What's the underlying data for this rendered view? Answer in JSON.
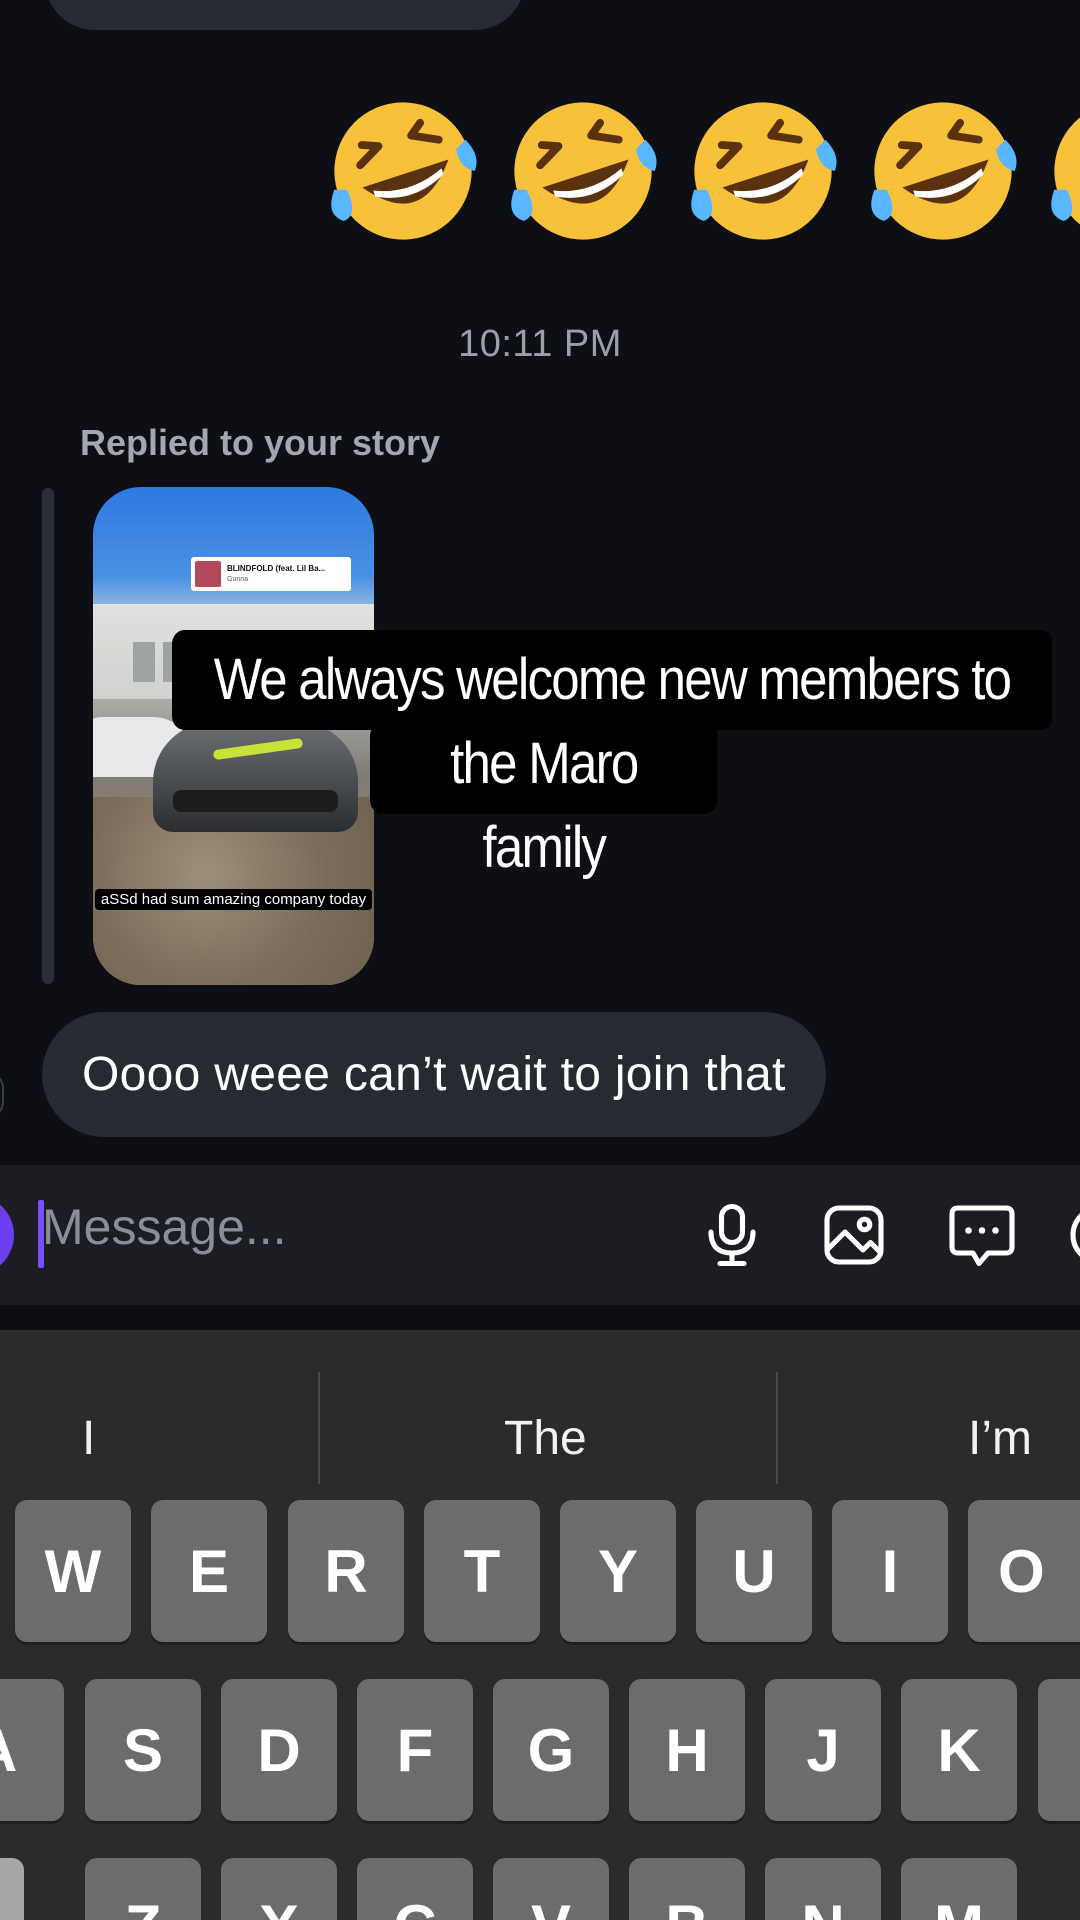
{
  "conversation": {
    "emoji_reaction": "🤣🤣🤣🤣🤣",
    "timestamp": "10:11 PM",
    "reply_label": "Replied to your story",
    "story": {
      "music_title": "BLINDFOLD (feat. Lil Ba...",
      "music_artist": "Gunna",
      "caption": "aSSd had sum amazing company today"
    },
    "overlay_caption": {
      "line1": "We always welcome new members to",
      "line2": "the Maro family"
    },
    "sent_message": "Oooo weee can’t wait to join that"
  },
  "composer": {
    "placeholder": "Message...",
    "icons": [
      "microphone-icon",
      "image-icon",
      "chat-bubble-icon"
    ]
  },
  "keyboard": {
    "suggestions": [
      "I",
      "The",
      "I’m"
    ],
    "row1": [
      "W",
      "E",
      "R",
      "T",
      "Y",
      "U",
      "I",
      "O"
    ],
    "row2": [
      "A",
      "S",
      "D",
      "F",
      "G",
      "H",
      "J",
      "K"
    ],
    "row3": [
      "Z",
      "X",
      "C",
      "V",
      "B",
      "N",
      "M"
    ]
  }
}
